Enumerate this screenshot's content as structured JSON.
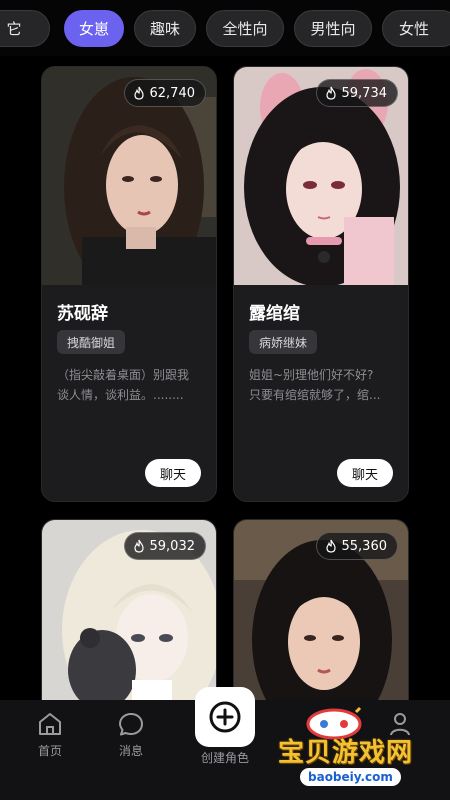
{
  "tabs": [
    {
      "label": "它",
      "active": false
    },
    {
      "label": "女崽",
      "active": true
    },
    {
      "label": "趣味",
      "active": false
    },
    {
      "label": "全性向",
      "active": false
    },
    {
      "label": "男性向",
      "active": false
    },
    {
      "label": "女性",
      "active": false
    }
  ],
  "cards": [
    {
      "heat": "62,740",
      "name": "苏砚辞",
      "tag": "拽酷御姐",
      "desc_line1": "（指尖敲着桌面）别跟我",
      "desc_line2": "谈人情，谈利益。........",
      "chat_label": "聊天"
    },
    {
      "heat": "59,734",
      "name": "露绾绾",
      "tag": "病娇继妹",
      "desc_line1": "姐姐~别理他们好不好?",
      "desc_line2": "只要有绾绾就够了，绾...",
      "chat_label": "聊天"
    },
    {
      "heat": "59,032"
    },
    {
      "heat": "55,360"
    }
  ],
  "nav": {
    "home": "首页",
    "messages": "消息",
    "create": "创建角色"
  },
  "watermark": {
    "title": "宝贝游戏网",
    "url": "baobeiy.com"
  },
  "colors": {
    "accent": "#6b63ef",
    "background": "#000000",
    "card": "#1c1c1f"
  }
}
